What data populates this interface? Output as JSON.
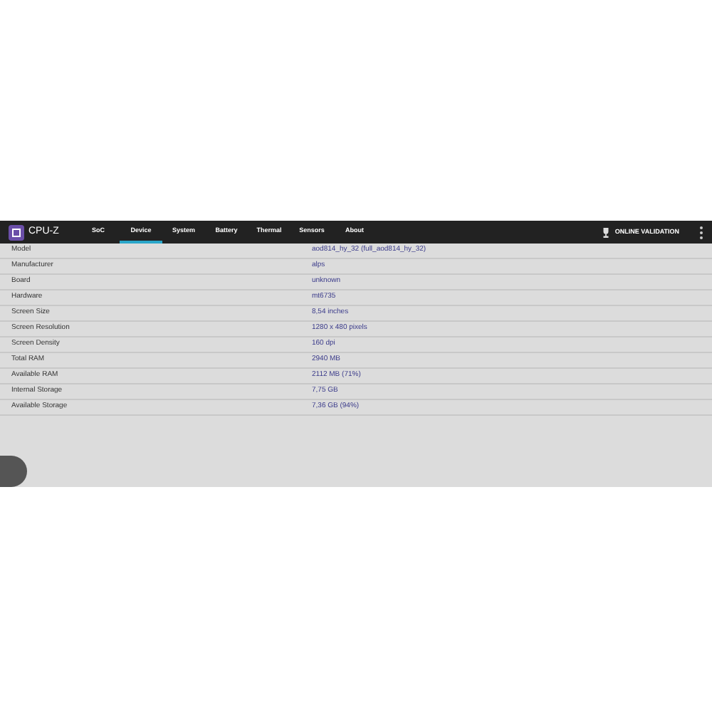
{
  "app": {
    "title": "CPU-Z"
  },
  "tabs": [
    {
      "label": "SoC",
      "selected": false
    },
    {
      "label": "Device",
      "selected": true
    },
    {
      "label": "System",
      "selected": false
    },
    {
      "label": "Battery",
      "selected": false
    },
    {
      "label": "Thermal",
      "selected": false
    },
    {
      "label": "Sensors",
      "selected": false
    },
    {
      "label": "About",
      "selected": false
    }
  ],
  "validation_button": "ONLINE VALIDATION",
  "rows": [
    {
      "label": "Model",
      "value": "aod814_hy_32 (full_aod814_hy_32)"
    },
    {
      "label": "Manufacturer",
      "value": "alps"
    },
    {
      "label": "Board",
      "value": "unknown"
    },
    {
      "label": "Hardware",
      "value": "mt6735"
    },
    {
      "label": "Screen Size",
      "value": "8,54 inches"
    },
    {
      "label": "Screen Resolution",
      "value": "1280 x 480 pixels"
    },
    {
      "label": "Screen Density",
      "value": "160 dpi"
    },
    {
      "label": "Total RAM",
      "value": "2940 MB"
    },
    {
      "label": "Available RAM",
      "value": "2112 MB  (71%)"
    },
    {
      "label": "Internal Storage",
      "value": "7,75 GB"
    },
    {
      "label": "Available Storage",
      "value": "7,36 GB (94%)"
    }
  ]
}
